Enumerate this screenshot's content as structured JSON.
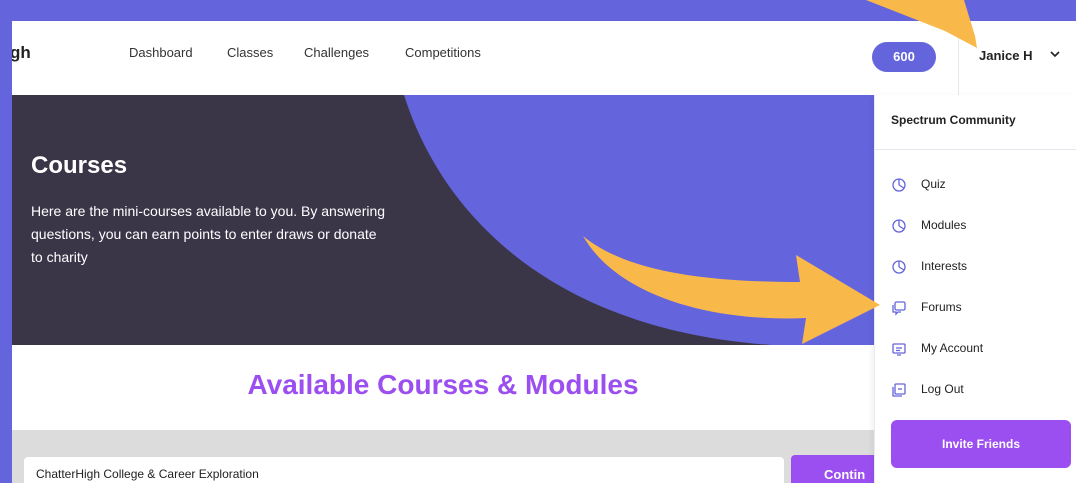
{
  "logo": {
    "text": "gh"
  },
  "nav": {
    "links": [
      "Dashboard",
      "Classes",
      "Challenges",
      "Competitions"
    ]
  },
  "points": "600",
  "user": {
    "name": "Janice H"
  },
  "hero": {
    "title": "Courses",
    "text": "Here are the mini-courses available to you. By answering questions, you can earn points to enter draws or donate to charity"
  },
  "available_title": "Available Courses & Modules",
  "course": {
    "name": "ChatterHigh College & Career Exploration",
    "button": "Contin"
  },
  "menu": {
    "title": "Spectrum Community",
    "items": [
      {
        "label": "Quiz",
        "icon": "pie-chart-icon"
      },
      {
        "label": "Modules",
        "icon": "pie-chart-icon"
      },
      {
        "label": "Interests",
        "icon": "pie-chart-icon"
      },
      {
        "label": "Forums",
        "icon": "chat-bubbles-icon"
      },
      {
        "label": "My Account",
        "icon": "account-icon"
      },
      {
        "label": "Log Out",
        "icon": "logout-icon"
      }
    ],
    "invite": "Invite Friends"
  },
  "colors": {
    "brand": "#6464dc",
    "purple": "#9b4ff0",
    "hero_dark": "#3b3548",
    "arrow": "#f8b94a"
  }
}
